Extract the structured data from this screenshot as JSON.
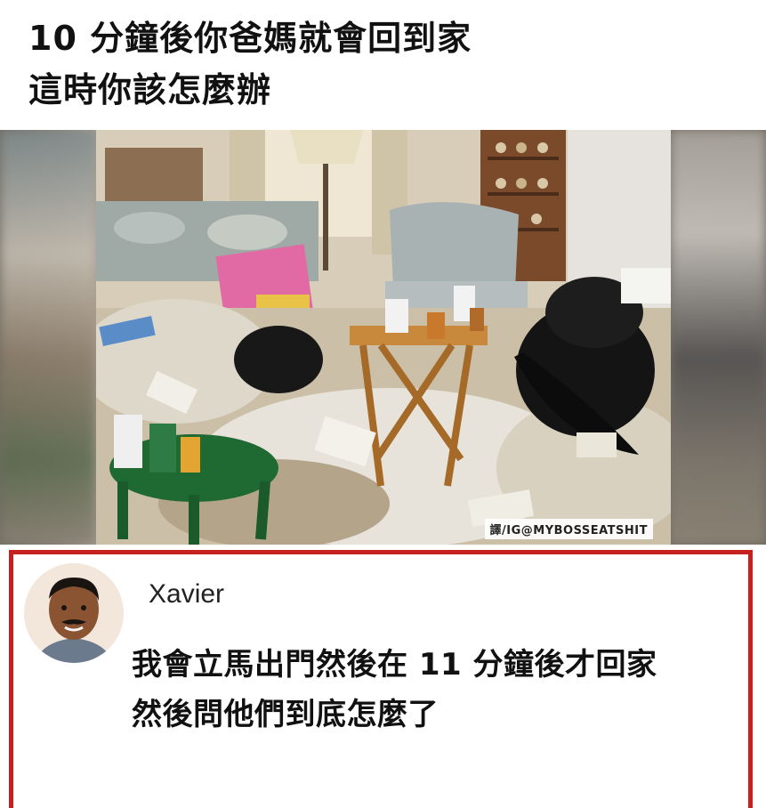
{
  "headline": {
    "line1": "10 分鐘後你爸媽就會回到家",
    "line2": "這時你該怎麼辦"
  },
  "photo": {
    "credit": "譯/IG@MYBOSSEATSHIT"
  },
  "comment": {
    "username": "Xavier",
    "line1": "我會立馬出門然後在 11 分鐘後才回家",
    "line2": "然後問他們到底怎麼了"
  },
  "colors": {
    "card_border": "#c6201f"
  }
}
